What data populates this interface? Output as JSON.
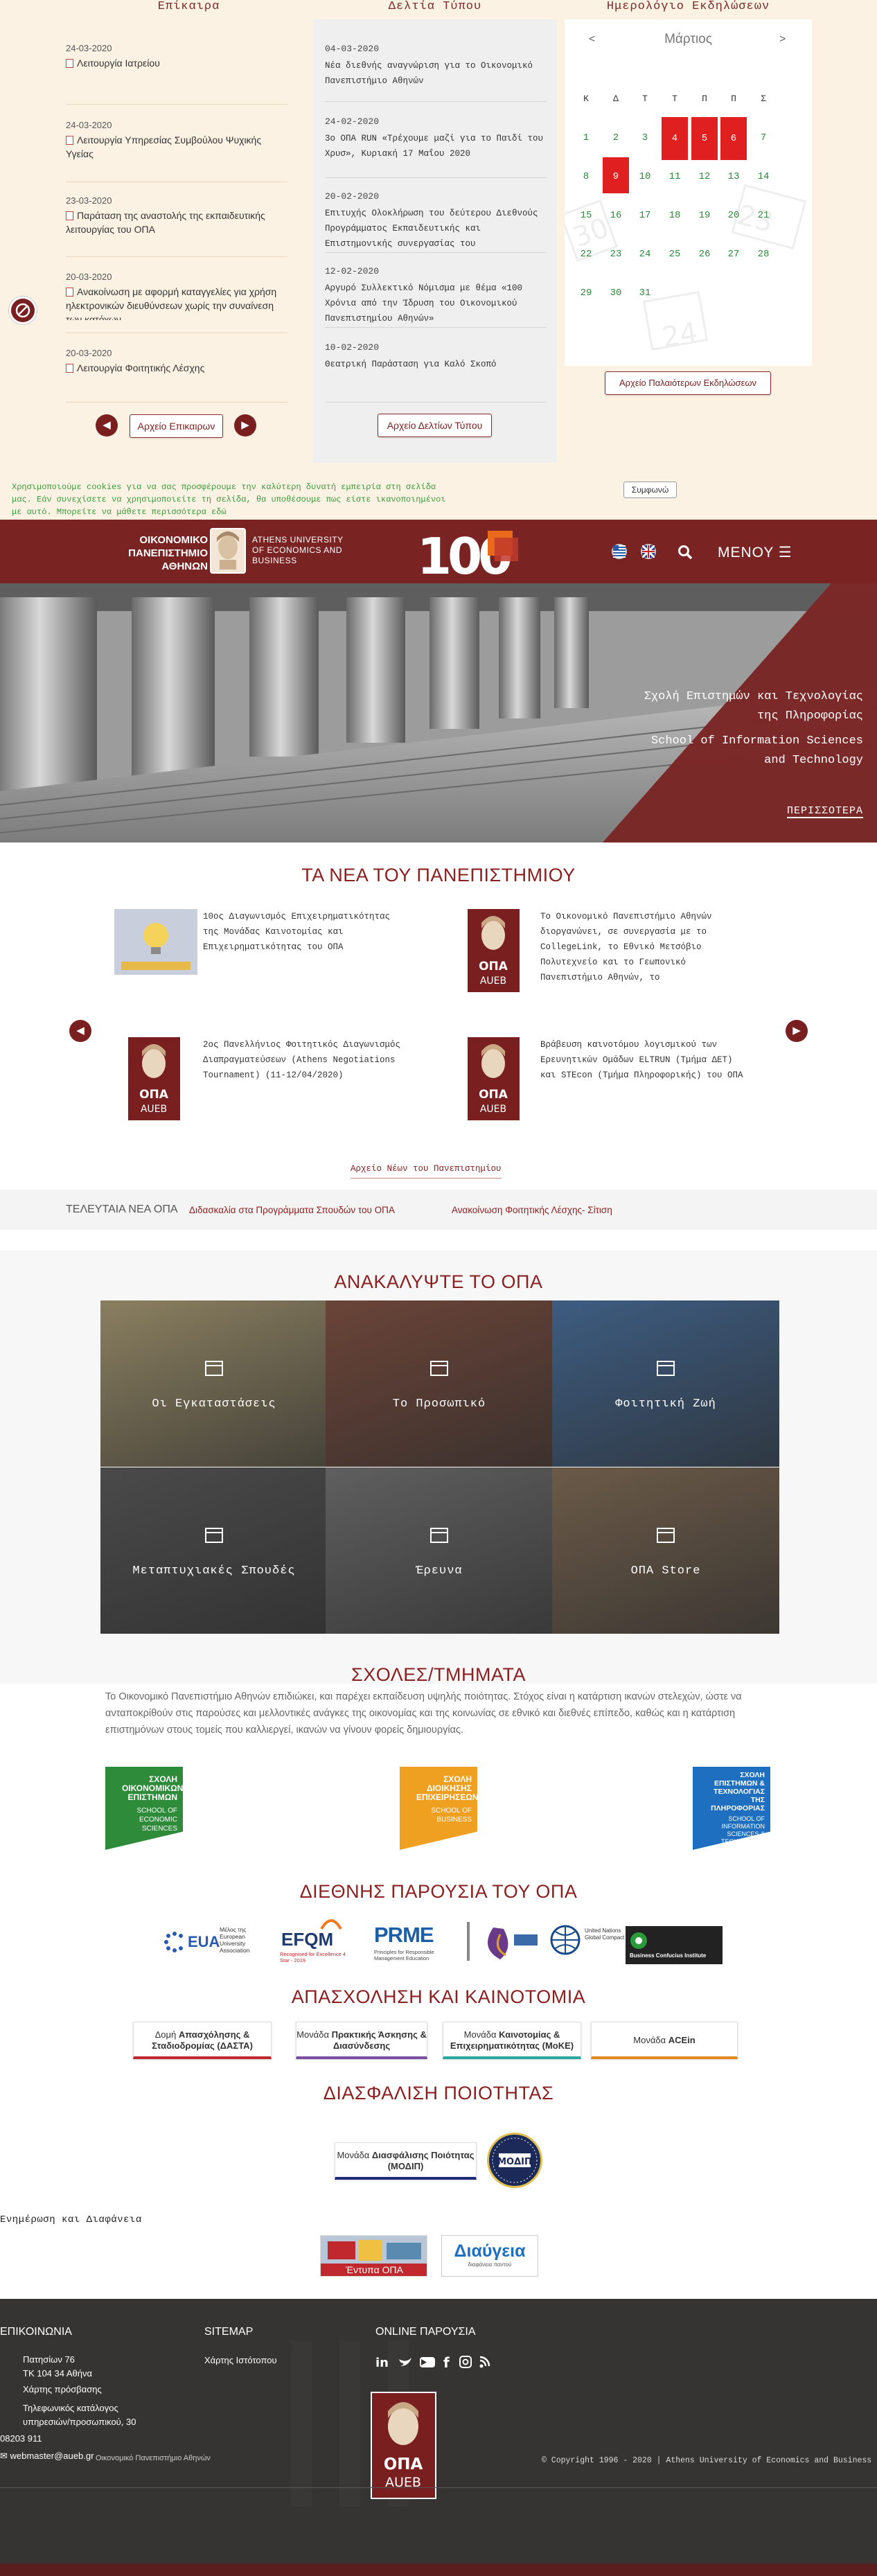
{
  "top": {
    "announcements_heading": "Επίκαιρα",
    "press_heading": "Δελτία Τύπου",
    "calendar_heading": "Ημερολόγιο Εκδηλώσεων",
    "announcements": [
      {
        "date": "24-03-2020",
        "title": "Λειτουργία Ιατρείου"
      },
      {
        "date": "24-03-2020",
        "title": "Λειτουργία Υπηρεσίας Συμβούλου Ψυχικής Υγείας"
      },
      {
        "date": "23-03-2020",
        "title": "Παράταση της αναστολής της εκπαιδευτικής λειτουργίας του ΟΠΑ"
      },
      {
        "date": "20-03-2020",
        "title": "Ανακοίνωση με αφορμή καταγγελίες για χρήση ηλεκτρονικών διευθύνσεων χωρίς την συναίνεση των κατόχων"
      },
      {
        "date": "20-03-2020",
        "title": "Λειτουργία Φοιτητικής Λέσχης"
      }
    ],
    "announcements_archive": "Αρχείο Επικαιρων",
    "press": [
      {
        "date": "04-03-2020",
        "title": "Νέα διεθνής αναγνώριση για το Οικονομικό Πανεπιστήμιο Αθηνών"
      },
      {
        "date": "24-02-2020",
        "title": "3ο ΟΠΑ RUN «Τρέχουμε μαζί για το Παιδί του Χρυσ», Κυριακή 17 Μαΐου 2020"
      },
      {
        "date": "20-02-2020",
        "title": "Επιτυχής Ολοκλήρωση του δεύτερου Διεθνούς Προγράμματος Εκπαιδευτικής και Επιστημονικής συνεργασίας του"
      },
      {
        "date": "12-02-2020",
        "title": "Αργυρό Συλλεκτικό Νόμισμα με θέμα «100 Χρόνια από την Ίδρυση του Οικονομικού Πανεπιστημίου Αθηνών»"
      },
      {
        "date": "10-02-2020",
        "title": "Θεατρική Παράσταση για Καλό Σκοπό"
      }
    ],
    "press_archive": "Αρχείο Δελτίων Τύπου",
    "calendar": {
      "month": "Μάρτιος",
      "prev": "<",
      "next": ">",
      "weekdays": [
        "Κ",
        "Δ",
        "Τ",
        "Τ",
        "Π",
        "Π",
        "Σ"
      ],
      "weeks": [
        [
          "1",
          "2",
          "3",
          "4",
          "5",
          "6",
          "7"
        ],
        [
          "8",
          "9",
          "10",
          "11",
          "12",
          "13",
          "14"
        ],
        [
          "15",
          "16",
          "17",
          "18",
          "19",
          "20",
          "21"
        ],
        [
          "22",
          "23",
          "24",
          "25",
          "26",
          "27",
          "28"
        ],
        [
          "29",
          "30",
          "31",
          "",
          "",
          "",
          ""
        ]
      ],
      "highlighted": [
        "4",
        "5",
        "6",
        "9"
      ],
      "archive": "Αρχείο Παλαιότερων Εκδηλώσεων"
    }
  },
  "cookie": {
    "text": "Χρησιμοποιούμε cookies για να σας προσφέρουμε την καλύτερη δυνατή εμπειρία στη σελίδα μας. Εάν συνεχίσετε να χρησιμοποιείτε τη σελίδα, θα υποθέσουμε πως είστε ικανοποιημένοι με αυτό.  Μπορείτε να μάθετε περισσότερα εδώ",
    "button": "Συμφωνώ"
  },
  "header": {
    "logo_greek": "ΟΙΚΟΝΟΜΙΚΟ ΠΑΝΕΠΙΣΤΗΜΙΟ ΑΘΗΝΩΝ",
    "logo_english": "ATHENS UNIVERSITY OF ECONOMICS AND BUSINESS",
    "anniversary": "100",
    "menu": "ΜΕΝΟΥ"
  },
  "hero": {
    "title_gr": "Σχολή Επιστημών και Τεχνολογίας της Πληροφορίας",
    "title_en": "School of Information Sciences and Technology",
    "more": "ΠΕΡΙΣΣΟΤΕΡΑ"
  },
  "news": {
    "title": "ΤΑ ΝΕΑ ΤΟΥ ΠΑΝΕΠΙΣΤΗΜΙΟΥ",
    "items": [
      {
        "text": "10ος Διαγωνισμός Επιχειρηματικότητας της Μονάδας Καινοτομίας και Επιχειρηματικότητας του ΟΠΑ",
        "thumb": "bulb"
      },
      {
        "text": "Το Οικονομικό Πανεπιστήμιο Αθηνών διοργανώνει, σε συνεργασία με το CollegeLink, το Εθνικό Μετσόβιο Πολυτεχνείο και το Γεωπονικό Πανεπιστήμιο Αθηνών, το",
        "thumb": "aueb"
      },
      {
        "text": "2ος Πανελλήνιος Φοιτητικός Διαγωνισμός Διαπραγματεύσεων (Athens Negotiations Tournament) (11-12/04/2020)",
        "thumb": "aueb"
      },
      {
        "text": "Βράβευση καινοτόμου λογισμικού των Ερευνητικών Ομάδων ELTRUN (Τμήμα ΔΕΤ) και STEcon (Τμήμα Πληροφορικής) του ΟΠΑ",
        "thumb": "aueb"
      }
    ],
    "aueb_mark": "ΟΠΑ AUEB",
    "archive": "Αρχείο Νέων του Πανεπιστημίου"
  },
  "ticker": {
    "label": "ΤΕΛΕΥΤΑΙΑ ΝΕΑ ΟΠΑ",
    "items": [
      "Διδασκαλία στα Προγράμματα Σπουδών του ΟΠΑ",
      "Ανακοίνωση Φοιτητικής Λέσχης- Σίτιση"
    ]
  },
  "discover": {
    "title": "ΑΝΑΚΑΛΥΨΤΕ ΤΟ ΟΠΑ",
    "tiles": [
      {
        "label": "Οι Εγκαταστάσεις",
        "color": "#8a7f60"
      },
      {
        "label": "Το Προσωπικό",
        "color": "#6a4438"
      },
      {
        "label": "Φοιτητική Ζωή",
        "color": "#3d5c80"
      },
      {
        "label": "Μεταπτυχιακές Σπουδές",
        "color": "#4a4a4a"
      },
      {
        "label": "Έρευνα",
        "color": "#5f5f5f"
      },
      {
        "label": "ΟΠΑ Store",
        "color": "#6b5a48"
      }
    ]
  },
  "schools": {
    "title": "ΣΧΟΛΕΣ/ΤΜΗΜΑΤΑ",
    "text": "Το Οικονομικό Πανεπιστήμιο Αθηνών επιδιώκει, και παρέχει εκπαίδευση υψηλής ποιότητας. Στόχος είναι η κατάρτιση ικανών στελεχών, ώστε να ανταποκρίθούν στις παρούσες και μελλοντικές ανάγκες της οικονομίας και της κοινωνίας σε εθνικό και διεθνές επίπεδο, καθώς και η κατάρτιση επιστημόνων στους τομείς που καλλιεργεί, ικανών να γίνουν φορείς δημιουργίας.",
    "logos": [
      {
        "gr": "ΣΧΟΛΗ ΟΙΚΟΝΟΜΙΚΩΝ ΕΠΙΣΤΗΜΩΝ",
        "en": "SCHOOL OF ECONOMIC SCIENCES",
        "color": "#2e8b3a"
      },
      {
        "gr": "ΣΧΟΛΗ ΔΙΟΙΚΗΣΗΣ ΕΠΙΧΕΙΡΗΣΕΩΝ",
        "en": "SCHOOL OF BUSINESS",
        "color": "#f0a020"
      },
      {
        "gr": "ΣΧΟΛΗ ΕΠΙΣΤΗΜΩΝ & ΤΕΧΝΟΛΟΓΙΑΣ ΤΗΣ ΠΛΗΡΟΦΟΡΙΑΣ",
        "en": "SCHOOL OF INFORMATION SCIENCES & TECHNOLOGY",
        "color": "#1e6fc0"
      }
    ]
  },
  "international": {
    "title": "ΔΙΕΘΝΗΣ ΠΑΡΟΥΣΙΑ ΤΟΥ ΟΠΑ",
    "partners": [
      {
        "name": "EUA",
        "sub": "Μέλος της European University Association"
      },
      {
        "name": "EFQM",
        "sub": "Recognised for Excellence 4 Star - 2019"
      },
      {
        "name": "PRME",
        "sub": "Principles for Responsible Management Education"
      },
      {
        "name": "",
        "sub": ""
      },
      {
        "name": "",
        "sub": "United Nations Global Compact"
      },
      {
        "name": "",
        "sub": "Business Confucius Institute"
      }
    ]
  },
  "employment": {
    "title": "ΑΠΑΣΧΟΛΗΣΗ ΚΑΙ ΚΑΙΝΟΤΟΜΙΑ",
    "buttons": [
      {
        "pre": "Δομή ",
        "bold": "Απασχόλησης & Σταδιοδρομίας (ΔΑΣΤΑ)",
        "color": "#c0282e"
      },
      {
        "pre": "Μονάδα ",
        "bold": "Πρακτικής Άσκησης & Διασύνδεσης",
        "color": "#7a4fa0"
      },
      {
        "pre": "Μονάδα ",
        "bold": "Καινοτομίας & Επιχειρηματικότητας (ΜοΚΕ)",
        "color": "#2aa8a0"
      },
      {
        "pre": "Μονάδα ",
        "bold": "ACEin",
        "color": "#e08a20"
      }
    ]
  },
  "quality": {
    "title": "ΔΙΑΣΦΑΛΙΣΗ ΠΟΙΟΤΗΤΑΣ",
    "button_pre": "Μονάδα ",
    "button_bold": "Διασφάλισης Ποιότητας (ΜΟΔΙΠ)",
    "seal": "ΜΟΔΙΠ"
  },
  "transparency": {
    "heading": "Ενημέρωση και Διαφάνεια",
    "forms": "Έντυπα ΟΠΑ",
    "diavgeia": "Διαύγεια",
    "diavgeia_sub": "διαφάνεια παντού"
  },
  "footer": {
    "contact_title": "ΕΠΙΚΟΙΝΩΝΙΑ",
    "address1": "Πατησίων 76",
    "address2": "ΤΚ 104 34 Αθήνα",
    "map": "Χάρτης πρόσβασης",
    "phonebook": "Τηλεφωνικός κατάλογος υπηρεσιών/προσωπικού, 30",
    "phone": "08203 911",
    "email": "webmaster@aueb.gr",
    "sitemap_title": "SITEMAP",
    "sitemap_link": "Χάρτης Ιστότοπου",
    "online_title": "ONLINE ΠΑΡΟΥΣΙΑ",
    "aueb_mark": "ΟΠΑ AUEB",
    "address_line": "Οικονομικό Πανεπιστήμιο Αθηνών",
    "copyright": "© Copyright 1996 - 2020 | Athens University of Economics and Business"
  },
  "colors": {
    "brand": "#7a2323",
    "accent_red": "#e02020",
    "calendar_text": "#2a8a3a"
  }
}
